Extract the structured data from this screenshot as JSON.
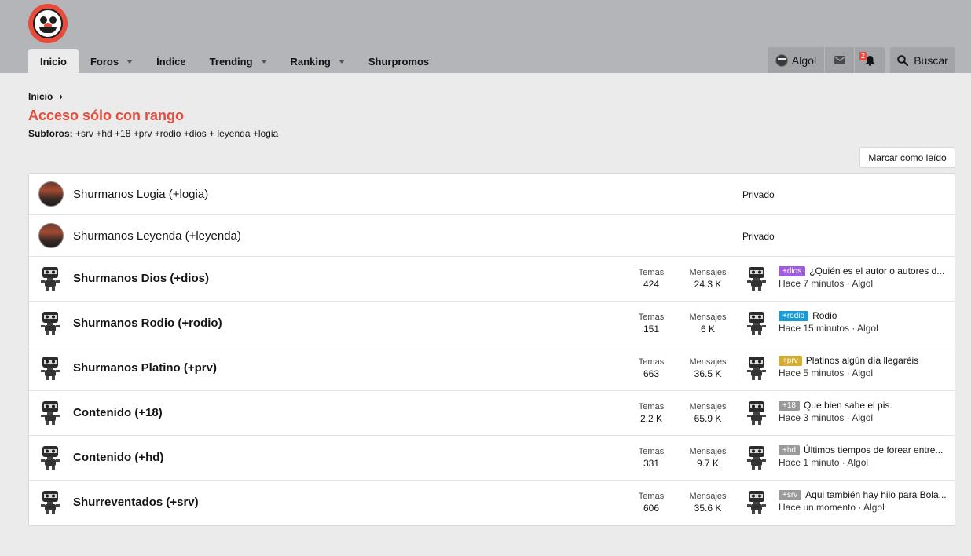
{
  "nav": {
    "tabs": [
      {
        "label": "Inicio",
        "active": true,
        "dropdown": false
      },
      {
        "label": "Foros",
        "active": false,
        "dropdown": true
      },
      {
        "label": "Índice",
        "active": false,
        "dropdown": false
      },
      {
        "label": "Trending",
        "active": false,
        "dropdown": true
      },
      {
        "label": "Ranking",
        "active": false,
        "dropdown": true
      },
      {
        "label": "Shurpromos",
        "active": false,
        "dropdown": false
      }
    ]
  },
  "user": {
    "name": "Algol",
    "notification_count": "2",
    "icons": [
      "user-avatar-icon",
      "envelope-icon",
      "bell-icon"
    ]
  },
  "search": {
    "label": "Buscar",
    "icon": "search-icon"
  },
  "breadcrumb": {
    "home": "Inicio"
  },
  "page": {
    "title": "Acceso sólo con rango",
    "subforos_label": "Subforos:",
    "subforos_list": "+srv +hd +18 +prv +rodio +dios + leyenda +logia",
    "mark_read": "Marcar como leído"
  },
  "stats_labels": {
    "temas": "Temas",
    "mensajes": "Mensajes"
  },
  "private_forums": [
    {
      "title": "Shurmanos Logia (+logia)",
      "status": "Privado"
    },
    {
      "title": "Shurmanos Leyenda (+leyenda)",
      "status": "Privado"
    }
  ],
  "forums": [
    {
      "title": "Shurmanos Dios (+dios)",
      "temas": "424",
      "mensajes": "24.3 K",
      "prefix": "+dios",
      "prefix_color": "#a05ce0",
      "last_title": "¿Quién es el autor o autores d...",
      "last_meta": "Hace 7 minutos · Algol"
    },
    {
      "title": "Shurmanos Rodio (+rodio)",
      "temas": "151",
      "mensajes": "6 K",
      "prefix": "+rodio",
      "prefix_color": "#1b9bd1",
      "last_title": "Rodio",
      "last_meta": "Hace 15 minutos · Algol"
    },
    {
      "title": "Shurmanos Platino (+prv)",
      "temas": "663",
      "mensajes": "36.5 K",
      "prefix": "+prv",
      "prefix_color": "#d6ad33",
      "last_title": "Platinos algún día llegaréis",
      "last_meta": "Hace 5 minutos · Algol"
    },
    {
      "title": "Contenido (+18)",
      "temas": "2.2 K",
      "mensajes": "65.9 K",
      "prefix": "+18",
      "prefix_color": "#9a9a9a",
      "last_title": "Que bien sabe el pis.",
      "last_meta": "Hace 3 minutos · Algol"
    },
    {
      "title": "Contenido (+hd)",
      "temas": "331",
      "mensajes": "9.7 K",
      "prefix": "+hd",
      "prefix_color": "#9a9a9a",
      "last_title": "Últimos tiempos de forear entre...",
      "last_meta": "Hace 1 minuto · Algol"
    },
    {
      "title": "Shurreventados (+srv)",
      "temas": "606",
      "mensajes": "35.6 K",
      "prefix": "+srv",
      "prefix_color": "#9a9a9a",
      "last_title": "Aqui también hay hilo para Bola...",
      "last_meta": "Hace un momento · Algol"
    }
  ]
}
